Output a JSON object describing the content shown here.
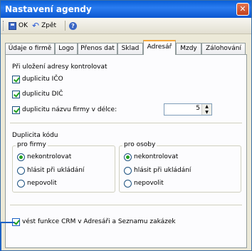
{
  "window": {
    "title": "Nastavení agendy"
  },
  "toolbar": {
    "ok_label": "OK",
    "back_label": "Zpět"
  },
  "tabs": [
    {
      "label": "Údaje o firmě"
    },
    {
      "label": "Logo"
    },
    {
      "label": "Přenos dat"
    },
    {
      "label": "Sklad"
    },
    {
      "label": "Adresář"
    },
    {
      "label": "Mzdy"
    },
    {
      "label": "Zálohování"
    }
  ],
  "active_tab": "Adresář",
  "save_section": {
    "title": "Při uložení adresy kontrolovat",
    "ico_label": "duplicitu IČO",
    "dic_label": "duplicitu DIČ",
    "name_label": "duplicitu názvu firmy v délce:",
    "name_length": "5"
  },
  "code_section": {
    "title": "Duplicita kódu",
    "firms": {
      "title": "pro firmy",
      "options": [
        "nekontrolovat",
        "hlásit při ukládání",
        "nepovolit"
      ],
      "selected": "nekontrolovat"
    },
    "persons": {
      "title": "pro osoby",
      "options": [
        "nekontrolovat",
        "hlásit při ukládání",
        "nepovolit"
      ],
      "selected": "nekontrolovat"
    }
  },
  "crm": {
    "label": "vést funkce CRM v Adresáři a Seznamu zakázek"
  }
}
